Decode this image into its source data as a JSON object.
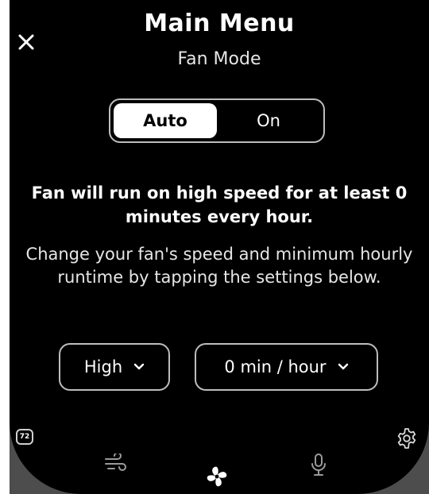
{
  "header": {
    "title": "Main Menu",
    "subtitle": "Fan Mode"
  },
  "mode_toggle": {
    "options": [
      "Auto",
      "On"
    ],
    "selected": "Auto"
  },
  "message": {
    "headline": "Fan will run on high speed for at least 0 minutes every hour.",
    "description": "Change your fan's speed and minimum hourly runtime by tapping the settings below."
  },
  "settings": {
    "speed": "High",
    "runtime": "0 min / hour"
  },
  "status": {
    "temperature": "72"
  },
  "icons": {
    "close": "close-icon",
    "settings": "gear-icon",
    "nav": [
      "wind-icon",
      "fan-icon",
      "microphone-icon"
    ]
  },
  "colors": {
    "background": "#000000",
    "device_frame": "#4d4d4d",
    "text": "#ffffff",
    "active_toggle": "#ffffff"
  }
}
